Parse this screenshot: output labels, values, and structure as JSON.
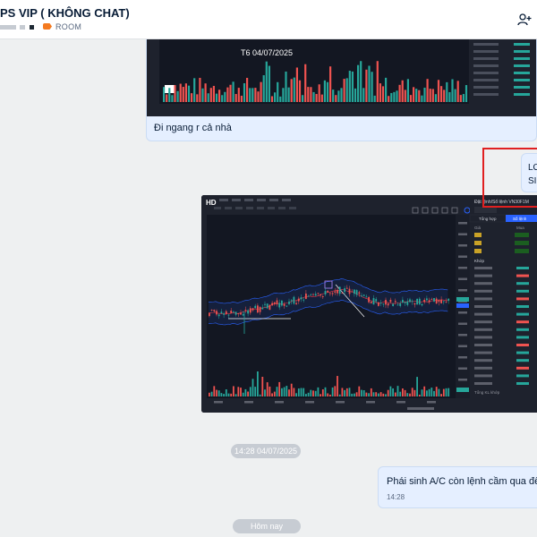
{
  "header": {
    "title": "PS VIP ( KHÔNG CHAT)",
    "room_label": "ROOM",
    "add_member_icon": "add-user-icon"
  },
  "message1": {
    "image_date_label": "T6 04/07/2025",
    "text": "Đi ngang r cả nhà"
  },
  "message2": {
    "line1": "LO",
    "line2": "SI"
  },
  "chart_image": {
    "logo": "HD",
    "order_panel_title": "Đặt lệnh/Sổ lệnh VN30F1M",
    "order_tab_buy": "Tổng hợp",
    "order_tab_sell": "Số lệnh",
    "col_price": "Giá",
    "col_buy": "Mua",
    "col_label_khop": "Khớp",
    "sum_label": "Tổng KL khớp",
    "accent": "#2962ff"
  },
  "timestamp_pill": "14:28 04/07/2025",
  "message3": {
    "text": "Phái sinh A/C còn lệnh cầm qua đêm đ",
    "time": "14:28"
  },
  "today_pill": "Hôm nay",
  "colors": {
    "bubble": "#e5efff",
    "up": "#26a69a",
    "down": "#ef5350",
    "highlight_box": "#e02020"
  }
}
